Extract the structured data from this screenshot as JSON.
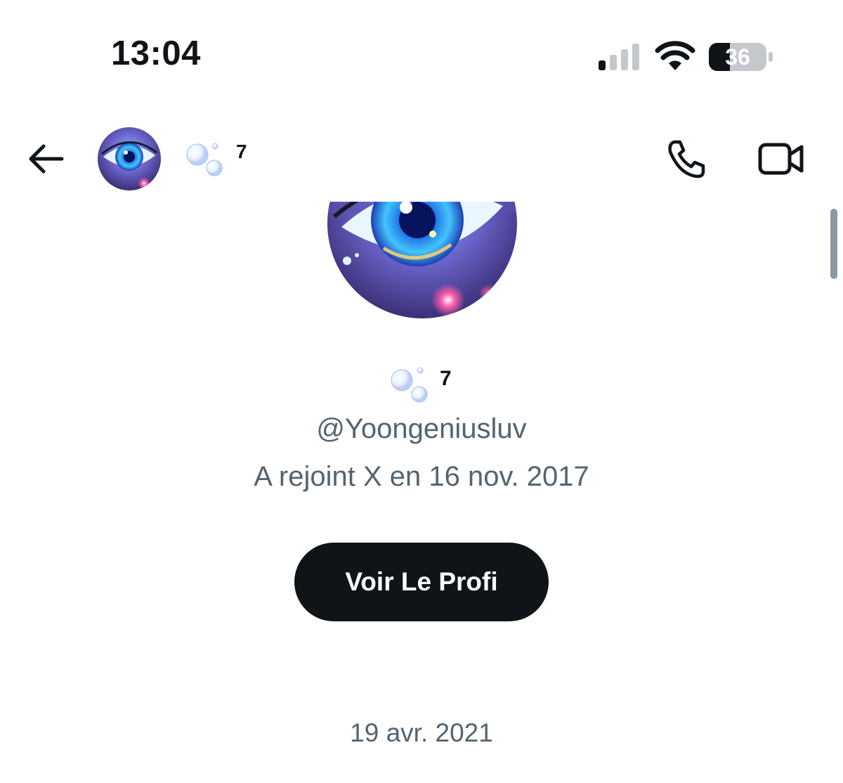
{
  "status_bar": {
    "time": "13:04",
    "battery_level": "36",
    "signal_bars_active": 1,
    "signal_bars_total": 4
  },
  "header": {
    "name_suffix": "7",
    "icons": [
      "back-arrow-icon",
      "avatar",
      "bubbles-icon",
      "phone-icon",
      "video-icon"
    ]
  },
  "profile": {
    "name_suffix": "7",
    "handle": "@Yoongeniusluv",
    "joined": "A rejoint X en 16 nov. 2017",
    "button_label": "Voir Le Profi"
  },
  "conversation": {
    "date_separator": "19 avr. 2021"
  },
  "colors": {
    "text_primary": "#0f1419",
    "text_secondary": "#536471",
    "button_bg": "#0f1419",
    "background": "#ffffff"
  }
}
